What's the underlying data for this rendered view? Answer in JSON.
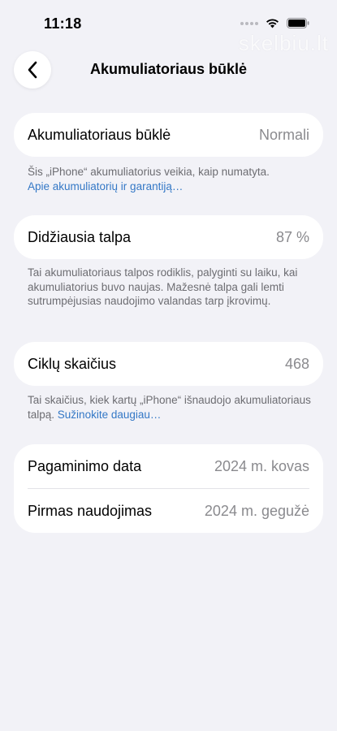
{
  "status_bar": {
    "time": "11:18",
    "watermark": "skelbiu.lt"
  },
  "nav": {
    "title": "Akumuliatoriaus būklė",
    "back_icon": "chevron-left-icon"
  },
  "battery_health": {
    "label": "Akumuliatoriaus būklė",
    "value": "Normali",
    "footnote_text": "Šis „iPhone“ akumuliatorius veikia, kaip numatyta.",
    "footnote_link": "Apie akumuliatorių ir garantiją…"
  },
  "max_capacity": {
    "label": "Didžiausia talpa",
    "value": "87 %",
    "footnote_text": "Tai akumuliatoriaus talpos rodiklis, palyginti su laiku, kai akumuliatorius buvo naujas. Mažesnė talpa gali lemti sutrumpėjusias naudojimo valandas tarp įkrovimų."
  },
  "cycle_count": {
    "label": "Ciklų skaičius",
    "value": "468",
    "footnote_text": "Tai skaičius, kiek kartų „iPhone“ išnaudojo akumuliatoriaus talpą.",
    "footnote_link": "Sužinokite daugiau…"
  },
  "dates": {
    "manufacture_label": "Pagaminimo data",
    "manufacture_value": "2024 m. kovas",
    "first_use_label": "Pirmas naudojimas",
    "first_use_value": "2024 m. gegužė"
  },
  "colors": {
    "background": "#f2f2f7",
    "card": "#ffffff",
    "secondary_text": "#8a8a8e",
    "link": "#3478c6"
  }
}
